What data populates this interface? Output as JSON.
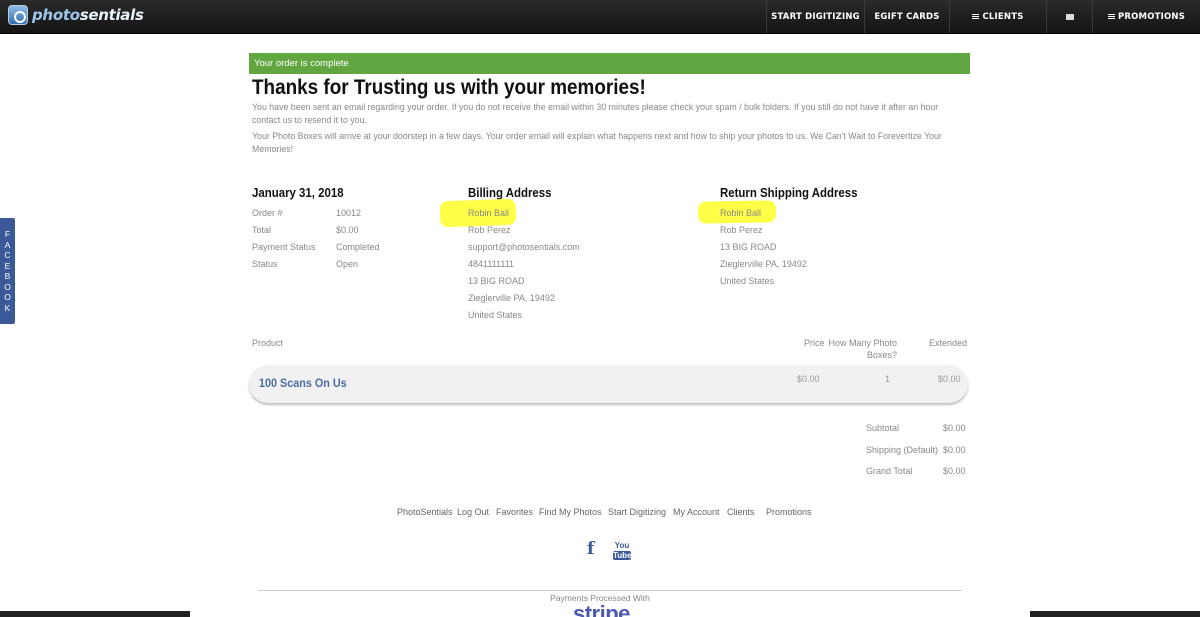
{
  "brand": {
    "logo_prefix": "photo",
    "logo_suffix": "sentials"
  },
  "nav": {
    "start_digitizing": "START DIGITIZING",
    "egift_cards": "EGIFT CARDS",
    "clients": "CLIENTS",
    "promotions": "PROMOTIONS",
    "icons": [
      "menu-icon",
      "mail-icon"
    ]
  },
  "side_tab": {
    "letters": [
      "F",
      "A",
      "C",
      "E",
      "B",
      "O",
      "O",
      "K"
    ]
  },
  "banner": {
    "text": "Your order is complete",
    "color": "#62a642"
  },
  "heading": "Thanks for Trusting us with your memories!",
  "paragraphs": [
    "You have been sent an email regarding your order. If you do not receive the email within 30 minutes please check your spam / bulk folders. If you still do not have it after an hour contact us to resend it to you.",
    "Your Photo Boxes will arrive at your doorstep in a few days. Your order email will explain what happens next and how to ship your photos to us. We Can't Wait to Forevertize Your Memories!"
  ],
  "order": {
    "date": "January 31, 2018",
    "rows": [
      {
        "label": "Order #",
        "value": "10012"
      },
      {
        "label": "Total",
        "value": "$0.00"
      },
      {
        "label": "Payment Status",
        "value": "Completed"
      },
      {
        "label": "Status",
        "value": "Open"
      }
    ]
  },
  "billing": {
    "title": "Billing Address",
    "lines": [
      "Robin Ball",
      "Rob Perez",
      "support@photosentials.com",
      "4841111111",
      "13 BIG ROAD",
      "Zieglerville PA, 19492",
      "United States"
    ]
  },
  "shipping": {
    "title": "Return Shipping Address",
    "lines": [
      "Robin Ball",
      "Rob Perez",
      "13 BIG ROAD",
      "Zieglerville PA, 19492",
      "United States"
    ]
  },
  "highlight_color": "#ffff3d",
  "table": {
    "headers": {
      "product": "Product",
      "price": "Price",
      "qty_line1": "How Many Photo",
      "qty_line2": "Boxes?",
      "extended": "Extended"
    },
    "row": {
      "product": "100 Scans On Us",
      "price": "$0.00",
      "qty": "1",
      "extended": "$0.00"
    }
  },
  "totals": [
    {
      "label": "Subtotal",
      "value": "$0.00"
    },
    {
      "label": "Shipping (Default)",
      "value": "$0.00"
    },
    {
      "label": "Grand Total",
      "value": "$0.00"
    }
  ],
  "footer": {
    "links": [
      "PhotoSentials",
      "Log Out",
      "Favorites",
      "Find My Photos",
      "Start Digitizing",
      "My Account",
      "Clients",
      "Promotions"
    ],
    "facebook_glyph": "f",
    "youtube_you": "You",
    "youtube_tube": "Tube",
    "payments_text": "Payments Processed With",
    "stripe_text": "stripe"
  }
}
